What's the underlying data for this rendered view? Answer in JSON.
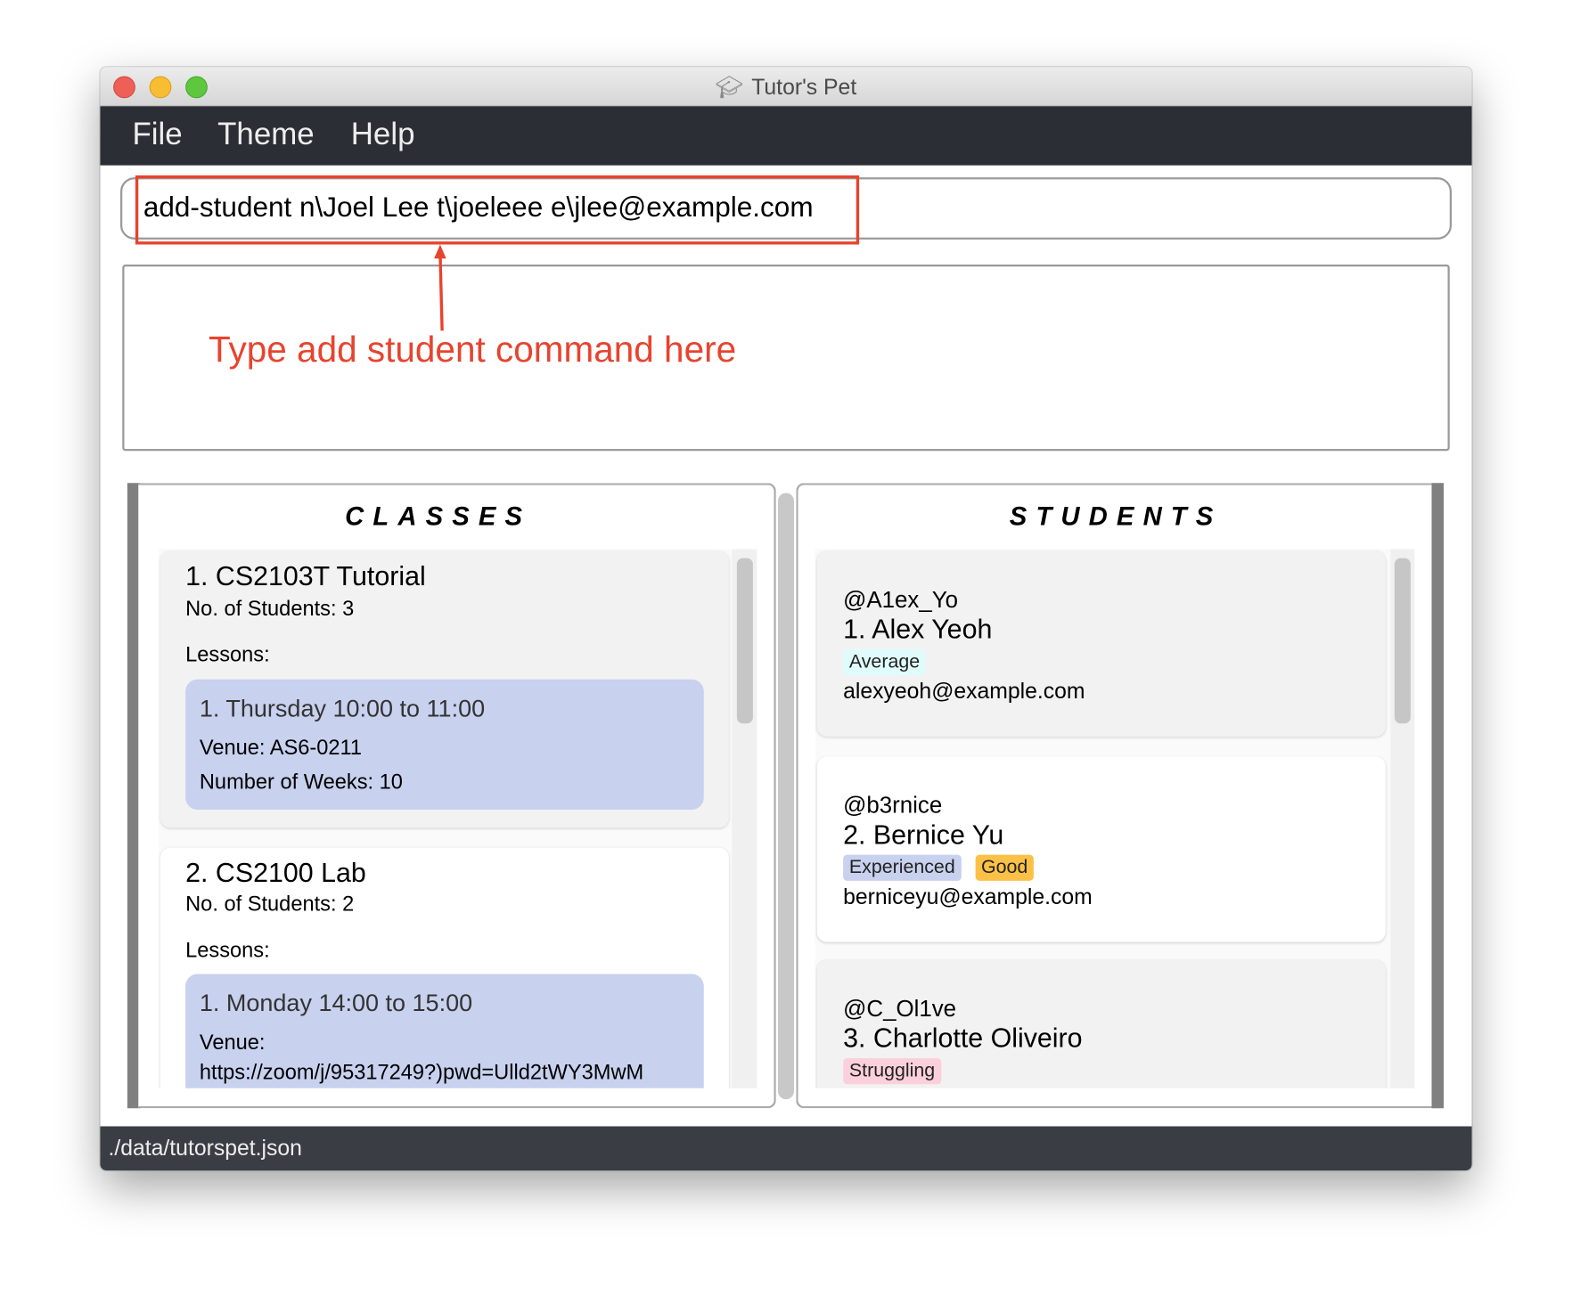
{
  "window": {
    "title": "Tutor's Pet",
    "title_icon": "mortarboard-icon"
  },
  "menu": {
    "items": [
      "File",
      "Theme",
      "Help"
    ]
  },
  "command": {
    "value": "add-student n\\Joel Lee t\\joeleee e\\jlee@example.com"
  },
  "annotation": {
    "text": "Type add student command here",
    "color": "#e8432e"
  },
  "classes": {
    "header": "CLASSES",
    "items": [
      {
        "title": "1.  CS2103T Tutorial",
        "students": "No. of Students:  3",
        "lessons_label": "Lessons:",
        "lessons": [
          {
            "time": "1. Thursday 10:00 to 11:00",
            "venue": "Venue: AS6-0211",
            "weeks": "Number of Weeks: 10"
          }
        ]
      },
      {
        "title": "2.  CS2100 Lab",
        "students": "No. of Students:  2",
        "lessons_label": "Lessons:",
        "lessons": [
          {
            "time": "1. Monday 14:00 to 15:00",
            "venue": "Venue:",
            "venue_value": "https://zoom/j/95317249?)pwd=Ulld2tWY3MwM"
          }
        ]
      }
    ]
  },
  "students": {
    "header": "STUDENTS",
    "items": [
      {
        "handle": "@A1ex_Yo",
        "name": "1.  Alex Yeoh",
        "tags": [
          {
            "label": "Average",
            "color": "#e0fbfb"
          }
        ],
        "email": "alexyeoh@example.com"
      },
      {
        "handle": "@b3rnice",
        "name": "2.  Bernice Yu",
        "tags": [
          {
            "label": "Experienced",
            "color": "#c8d1ee"
          },
          {
            "label": "Good",
            "color": "#fbc147"
          }
        ],
        "email": "berniceyu@example.com"
      },
      {
        "handle": "@C_Ol1ve",
        "name": "3.  Charlotte Oliveiro",
        "tags": [
          {
            "label": "Struggling",
            "color": "#fbd0dc"
          }
        ]
      }
    ]
  },
  "status": {
    "path": "./data/tutorspet.json"
  }
}
